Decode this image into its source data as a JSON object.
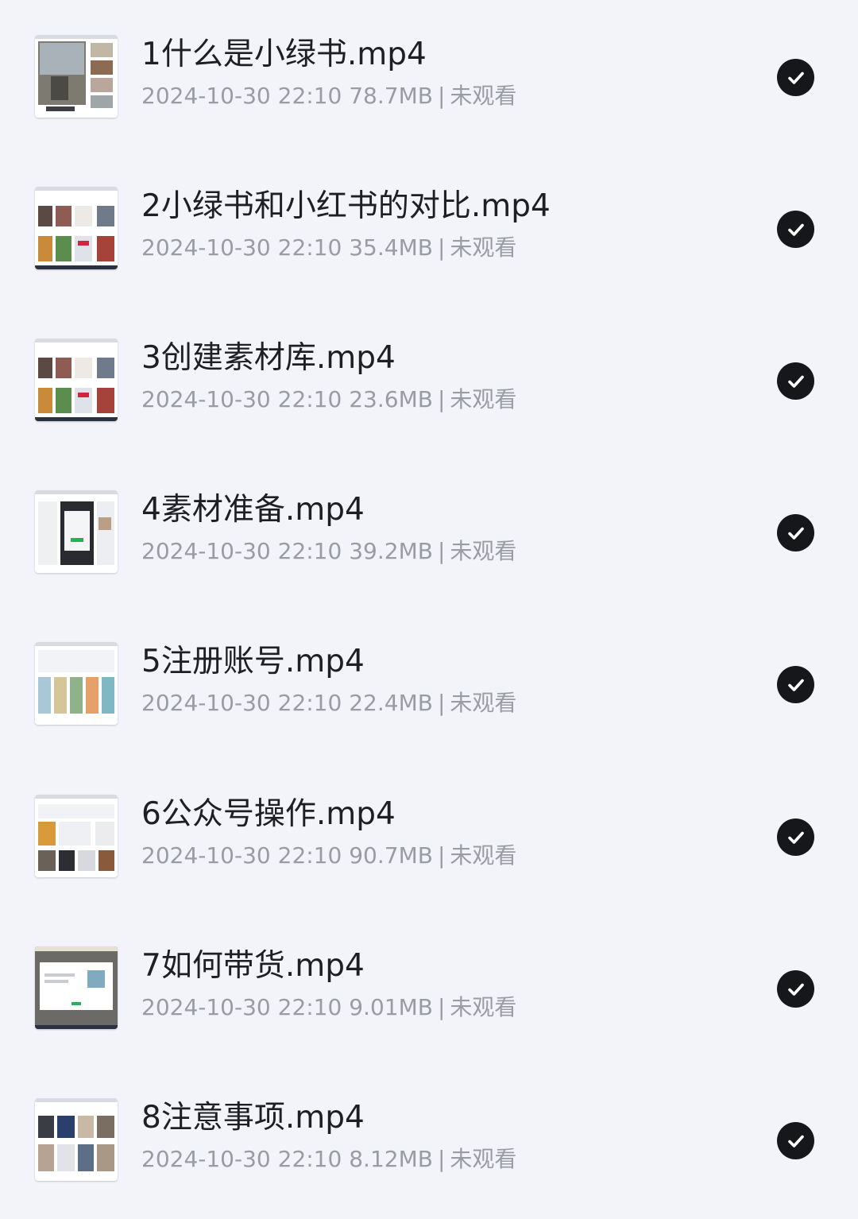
{
  "items": [
    {
      "title": "1什么是小绿书.mp4",
      "date": "2024-10-30 22:10",
      "size": "78.7MB",
      "separator": "|",
      "status": "未观看",
      "checked": true,
      "thumb_icon": "video-thumbnail"
    },
    {
      "title": "2小绿书和小红书的对比.mp4",
      "date": "2024-10-30 22:10",
      "size": "35.4MB",
      "separator": "|",
      "status": "未观看",
      "checked": true,
      "thumb_icon": "video-thumbnail"
    },
    {
      "title": "3创建素材库.mp4",
      "date": "2024-10-30 22:10",
      "size": "23.6MB",
      "separator": "|",
      "status": "未观看",
      "checked": true,
      "thumb_icon": "video-thumbnail"
    },
    {
      "title": "4素材准备.mp4",
      "date": "2024-10-30 22:10",
      "size": "39.2MB",
      "separator": "|",
      "status": "未观看",
      "checked": true,
      "thumb_icon": "video-thumbnail"
    },
    {
      "title": "5注册账号.mp4",
      "date": "2024-10-30 22:10",
      "size": "22.4MB",
      "separator": "|",
      "status": "未观看",
      "checked": true,
      "thumb_icon": "video-thumbnail"
    },
    {
      "title": "6公众号操作.mp4",
      "date": "2024-10-30 22:10",
      "size": "90.7MB",
      "separator": "|",
      "status": "未观看",
      "checked": true,
      "thumb_icon": "video-thumbnail"
    },
    {
      "title": "7如何带货.mp4",
      "date": "2024-10-30 22:10",
      "size": "9.01MB",
      "separator": "|",
      "status": "未观看",
      "checked": true,
      "thumb_icon": "video-thumbnail"
    },
    {
      "title": "8注意事项.mp4",
      "date": "2024-10-30 22:10",
      "size": "8.12MB",
      "separator": "|",
      "status": "未观看",
      "checked": true,
      "thumb_icon": "video-thumbnail"
    }
  ],
  "colors": {
    "background": "#f3f4f9",
    "title": "#1d1f24",
    "meta": "#9a9ca4",
    "check_fill": "#16171b",
    "check_mark": "#ffffff"
  }
}
